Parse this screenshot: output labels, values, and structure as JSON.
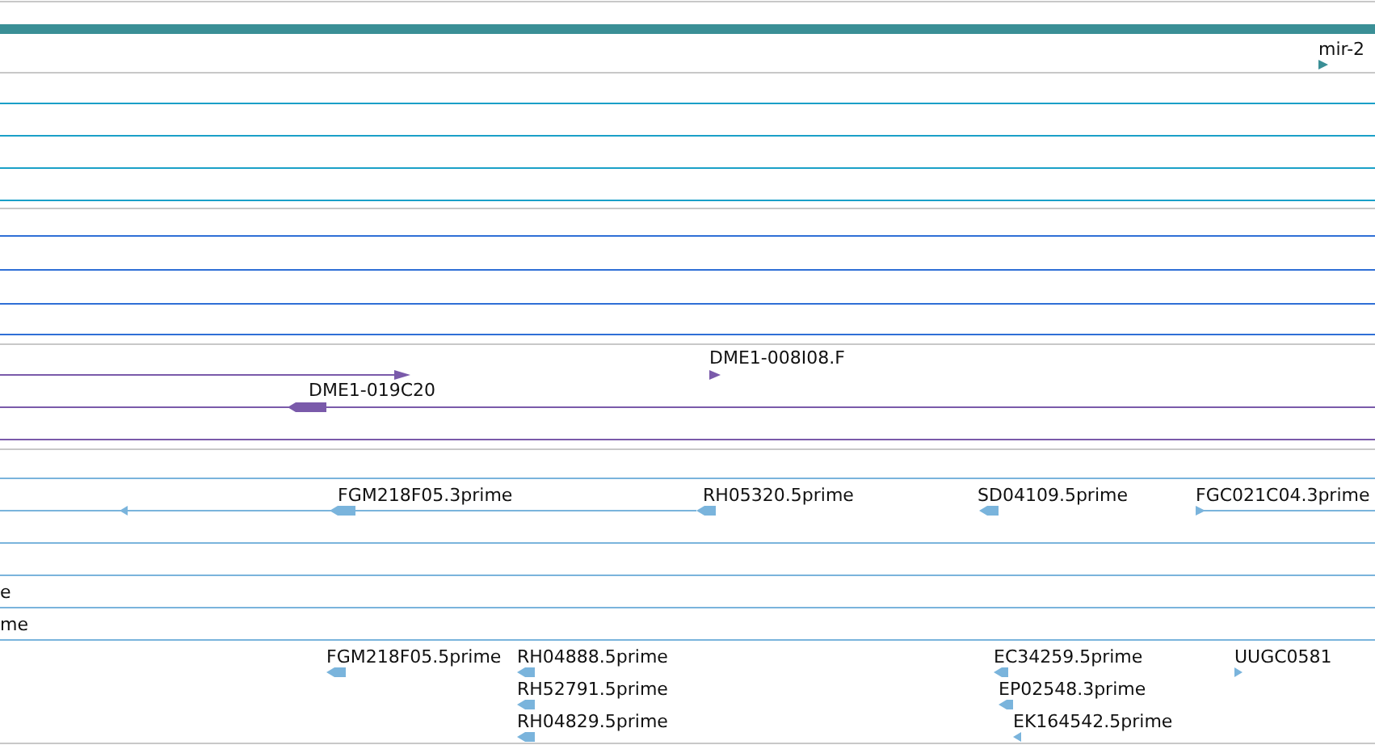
{
  "tracks": [
    {
      "color": "#3a8f96",
      "features": [
        {
          "label": "mir-2",
          "kind": "forward"
        }
      ]
    },
    {
      "color": "#1aa0c8"
    },
    {
      "color": "#2f6fd6"
    },
    {
      "color": "#7a5aaa",
      "features": [
        {
          "kind": "forward"
        },
        {
          "label": "DME1-008I08.F",
          "kind": "forward"
        },
        {
          "label": "DME1-019C20",
          "kind": "reverse"
        }
      ]
    },
    {
      "color": "#7ab4dc",
      "features": [
        {
          "kind": "reverse"
        },
        {
          "label": "FGM218F05.3prime",
          "kind": "reverse"
        },
        {
          "label": "RH05320.5prime",
          "kind": "reverse"
        },
        {
          "label": "SD04109.5prime",
          "kind": "reverse"
        },
        {
          "label": "FGC021C04.3prime",
          "kind": "forward"
        },
        {
          "label": "e"
        },
        {
          "label": "me"
        },
        {
          "label": "FGM218F05.5prime",
          "kind": "reverse"
        },
        {
          "label": "RH04888.5prime",
          "kind": "reverse"
        },
        {
          "label": "RH52791.5prime",
          "kind": "reverse"
        },
        {
          "label": "RH04829.5prime",
          "kind": "reverse"
        },
        {
          "label": "EC34259.5prime",
          "kind": "reverse"
        },
        {
          "label": "EP02548.3prime",
          "kind": "reverse"
        },
        {
          "label": "EK164542.5prime",
          "kind": "reverse"
        },
        {
          "label": "UUGC0581",
          "kind": "forward"
        }
      ]
    }
  ]
}
